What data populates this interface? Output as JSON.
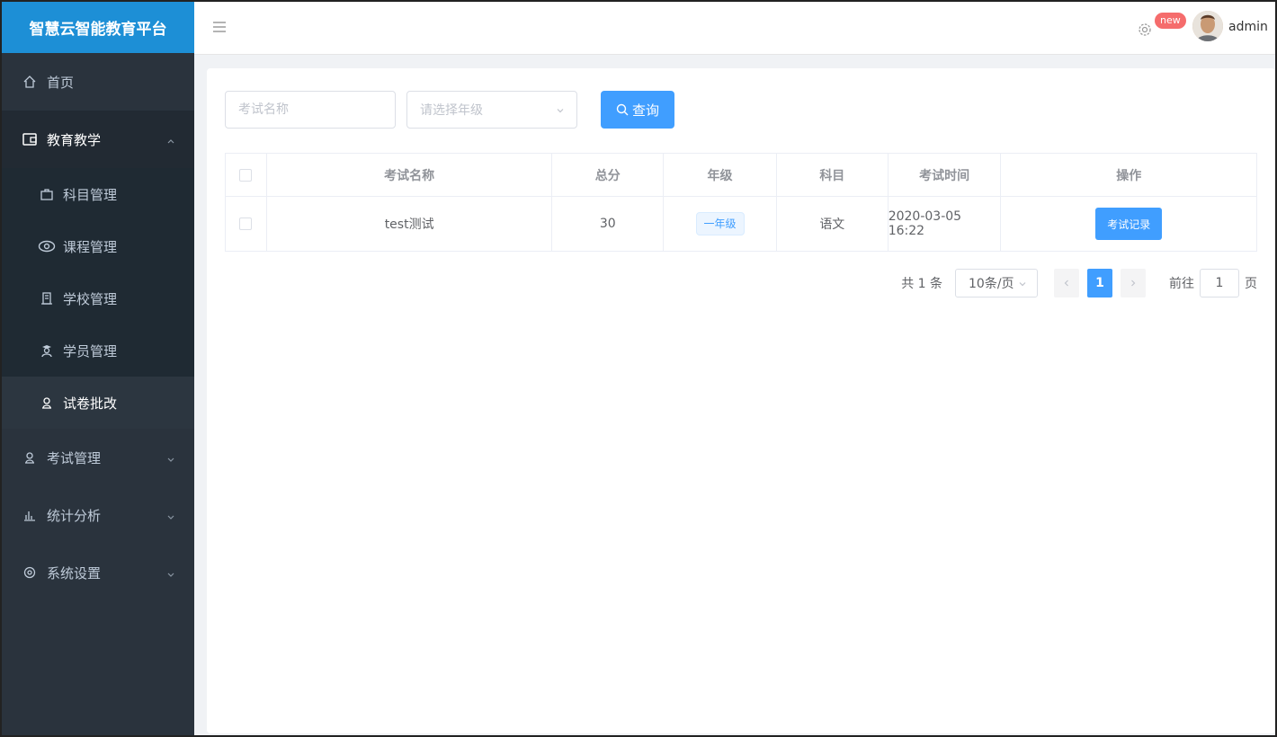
{
  "app": {
    "title": "智慧云智能教育平台"
  },
  "header": {
    "badge": "new",
    "username": "admin"
  },
  "sidebar": {
    "items": [
      {
        "label": "首页",
        "icon": "home-icon"
      },
      {
        "label": "教育教学",
        "icon": "wallet-icon",
        "expanded": true
      },
      {
        "label": "考试管理",
        "icon": "exam-icon"
      },
      {
        "label": "统计分析",
        "icon": "chart-icon"
      },
      {
        "label": "系统设置",
        "icon": "gear-icon"
      }
    ],
    "subitems": [
      {
        "label": "科目管理",
        "icon": "briefcase-icon"
      },
      {
        "label": "课程管理",
        "icon": "eye-icon"
      },
      {
        "label": "学校管理",
        "icon": "building-icon"
      },
      {
        "label": "学员管理",
        "icon": "student-icon"
      },
      {
        "label": "试卷批改",
        "icon": "grading-icon",
        "active": true
      }
    ]
  },
  "search": {
    "name_placeholder": "考试名称",
    "grade_placeholder": "请选择年级",
    "query_label": "查询"
  },
  "table": {
    "headers": [
      "考试名称",
      "总分",
      "年级",
      "科目",
      "考试时间",
      "操作"
    ],
    "rows": [
      {
        "name": "test测试",
        "total": "30",
        "grade": "一年级",
        "subject": "语文",
        "time": "2020-03-05 16:22",
        "action": "考试记录"
      }
    ]
  },
  "pagination": {
    "total_text": "共 1 条",
    "page_size": "10条/页",
    "current_page": "1",
    "goto_prefix": "前往",
    "goto_value": "1",
    "goto_suffix": "页"
  },
  "colors": {
    "primary": "#409eff",
    "sidebar": "#2a333d",
    "logo": "#1d8fd6",
    "badge": "#f56c6c"
  }
}
